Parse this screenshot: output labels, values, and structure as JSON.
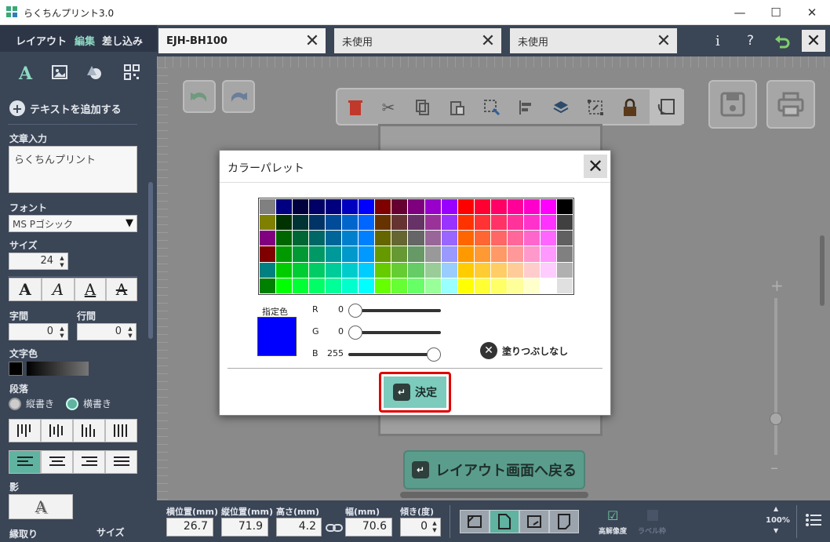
{
  "window": {
    "title": "らくちんプリント3.0"
  },
  "left": {
    "modes": [
      "レイアウト",
      "編集",
      "差し込み"
    ],
    "active_mode": 1,
    "add_text": "テキストを追加する",
    "text_input_label": "文章入力",
    "text_value": "らくちんプリント",
    "font_label": "フォント",
    "font_value": "MS Pゴシック",
    "size_label": "サイズ",
    "size_value": "24",
    "char_spacing_label": "字間",
    "char_spacing_value": "0",
    "line_spacing_label": "行間",
    "line_spacing_value": "0",
    "text_color_label": "文字色",
    "paragraph_label": "段落",
    "vertical_label": "縦書き",
    "horizontal_label": "横書き",
    "shadow_label": "影",
    "outline_label": "縁取り",
    "outline_size_label": "サイズ"
  },
  "tabs": [
    {
      "label": "EJH-BH100"
    },
    {
      "label": "未使用"
    },
    {
      "label": "未使用"
    }
  ],
  "canvas": {
    "back_label": "レイアウト画面へ戻る"
  },
  "bottom": {
    "x_label": "横位置(mm)",
    "x_value": "26.7",
    "y_label": "縦位置(mm)",
    "y_value": "71.9",
    "h_label": "高さ(mm)",
    "h_value": "4.2",
    "w_label": "幅(mm)",
    "w_value": "70.6",
    "tilt_label": "傾き(度)",
    "tilt_value": "0",
    "hires_label": "高解像度",
    "label_frame_label": "ラベル枠",
    "zoom_value": "100%"
  },
  "dialog": {
    "title": "カラーパレット",
    "current_label": "指定色",
    "current_color": "#0000ff",
    "r_label": "R",
    "r_value": "0",
    "g_label": "G",
    "g_value": "0",
    "b_label": "B",
    "b_value": "255",
    "no_fill_label": "塗りつぶしなし",
    "ok_label": "決定",
    "palette": [
      [
        "#808080",
        "#000080",
        "#00003f",
        "#000066",
        "#00007f",
        "#0000bf",
        "#0000ff",
        "#7f0000",
        "#660033",
        "#7f007f",
        "#9900cc",
        "#9900ff",
        "#ff0000",
        "#ff0033",
        "#ff0066",
        "#ff0099",
        "#ff00cc",
        "#ff00ff",
        "#000000"
      ],
      [
        "#808000",
        "#003300",
        "#003333",
        "#003366",
        "#004c99",
        "#0066cc",
        "#0066ff",
        "#663300",
        "#663333",
        "#663366",
        "#993399",
        "#9933ff",
        "#ff3300",
        "#ff3333",
        "#ff3366",
        "#ff3399",
        "#ff33cc",
        "#ff33ff",
        "#404040"
      ],
      [
        "#800080",
        "#006600",
        "#006633",
        "#006666",
        "#006699",
        "#0080cc",
        "#0080ff",
        "#666600",
        "#666633",
        "#666666",
        "#996699",
        "#9966ff",
        "#ff6600",
        "#ff6633",
        "#ff6666",
        "#ff6699",
        "#ff66cc",
        "#ff66ff",
        "#606060"
      ],
      [
        "#800000",
        "#009900",
        "#009933",
        "#009966",
        "#009999",
        "#0099cc",
        "#0099ff",
        "#669900",
        "#669933",
        "#669966",
        "#999999",
        "#9999ff",
        "#ff9900",
        "#ff9933",
        "#ff9966",
        "#ff9999",
        "#ff99cc",
        "#ff99ff",
        "#808080"
      ],
      [
        "#008080",
        "#00cc00",
        "#00cc33",
        "#00cc66",
        "#00cc99",
        "#00cccc",
        "#00ccff",
        "#66cc00",
        "#66cc33",
        "#66cc66",
        "#99cc99",
        "#99ccff",
        "#ffcc00",
        "#ffcc33",
        "#ffcc66",
        "#ffcc99",
        "#ffcccc",
        "#ffccff",
        "#b0b0b0"
      ],
      [
        "#008000",
        "#00ff00",
        "#00ff33",
        "#00ff66",
        "#00ff99",
        "#00ffcc",
        "#00ffff",
        "#66ff00",
        "#66ff33",
        "#66ff66",
        "#99ff99",
        "#99ffff",
        "#ffff00",
        "#ffff33",
        "#ffff66",
        "#ffff99",
        "#ffffcc",
        "#ffffff",
        "#e0e0e0"
      ]
    ]
  }
}
